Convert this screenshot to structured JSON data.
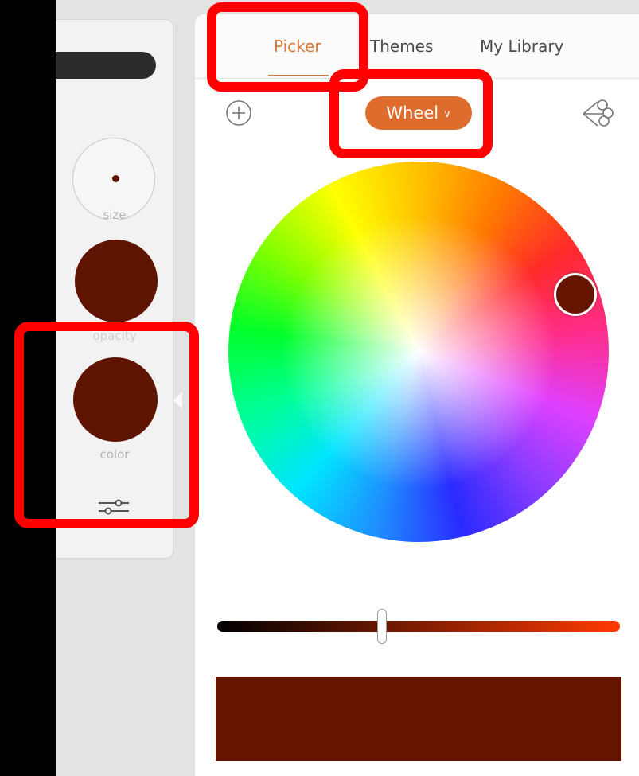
{
  "tool_panel": {
    "size_label": "size",
    "opacity_label": "opacity",
    "color_label": "color",
    "brush_color": "#5e1400"
  },
  "color_panel": {
    "tabs": [
      {
        "label": "Picker",
        "active": true
      },
      {
        "label": "Themes",
        "active": false
      },
      {
        "label": "My Library",
        "active": false
      }
    ],
    "mode_button_label": "Wheel",
    "selected_color": "#651400",
    "brightness_gradient": [
      "#000000",
      "#ff3a00"
    ],
    "brightness_level": 0.41,
    "icons": [
      "add-circle-icon",
      "color-harmony-icon",
      "chevron-down-icon",
      "sliders-icon"
    ]
  },
  "annotations": {
    "highlight_color": "#ff0000",
    "highlighted": [
      "picker-tab",
      "wheel-mode-button",
      "color-control"
    ]
  }
}
